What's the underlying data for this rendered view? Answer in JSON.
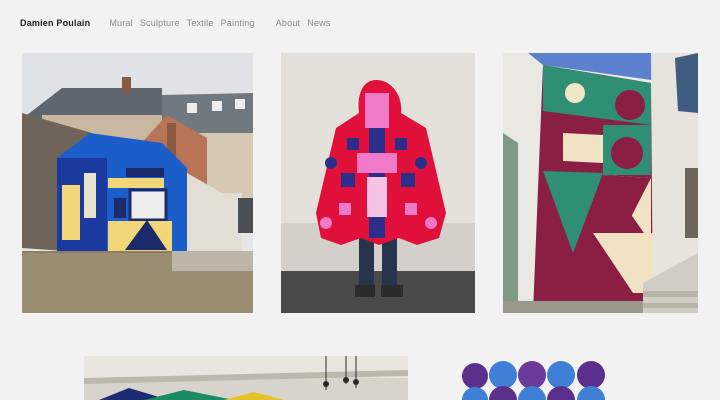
{
  "header": {
    "brand": "Damien Poulain",
    "nav_primary": [
      "Mural",
      "Sculpture",
      "Textile",
      "Painting"
    ],
    "nav_secondary": [
      "About",
      "News"
    ]
  },
  "gallery": {
    "items": [
      {
        "subject": "painted-house-mural"
      },
      {
        "subject": "pompom-coat-textile"
      },
      {
        "subject": "geometric-wall-mural"
      },
      {
        "subject": "interior-ceiling-installation"
      },
      {
        "subject": "pompom-sculpture"
      }
    ]
  },
  "colors": {
    "background": "#f2f2f2",
    "brand_text": "#222222",
    "nav_text": "#8a8a8a"
  }
}
